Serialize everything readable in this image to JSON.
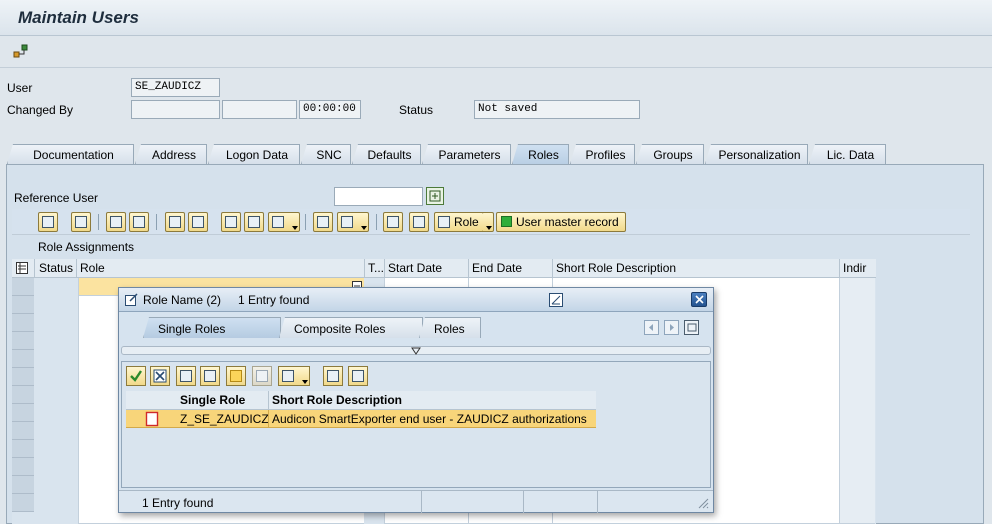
{
  "window": {
    "title": "Maintain Users"
  },
  "header": {
    "user_label": "User",
    "user_value": "SE_ZAUDICZ",
    "changed_by_label": "Changed By",
    "changed_by_value": "",
    "changed_date": "",
    "changed_time": "00:00:00",
    "status_label": "Status",
    "status_value": "Not saved"
  },
  "tabs": [
    "Documentation",
    "Address",
    "Logon Data",
    "SNC",
    "Defaults",
    "Parameters",
    "Roles",
    "Profiles",
    "Groups",
    "Personalization",
    "Lic. Data"
  ],
  "active_tab": "Roles",
  "roles_tab": {
    "reference_user_label": "Reference User",
    "reference_user_value": "",
    "role_button_label": "Role",
    "user_master_button_label": "User master record",
    "section_title": "Role Assignments",
    "columns": [
      "Status",
      "Role",
      "T...",
      "Start Date",
      "End Date",
      "Short Role Description",
      "Indir"
    ]
  },
  "popup": {
    "title": "Role Name (2)",
    "subtitle": "1 Entry found",
    "tabs": [
      "Single Roles",
      "Composite Roles",
      "Roles"
    ],
    "active_tab": "Single Roles",
    "columns": [
      "Single Role",
      "Short Role Description"
    ],
    "rows": [
      {
        "role": "Z_SE_ZAUDICZ",
        "description": "Audicon SmartExporter end user - ZAUDICZ authorizations"
      }
    ],
    "status": "1 Entry found"
  },
  "colors": {
    "selection": "#f8d57a",
    "accent_button": "#f1d98a",
    "panel": "#d5e1ec"
  }
}
